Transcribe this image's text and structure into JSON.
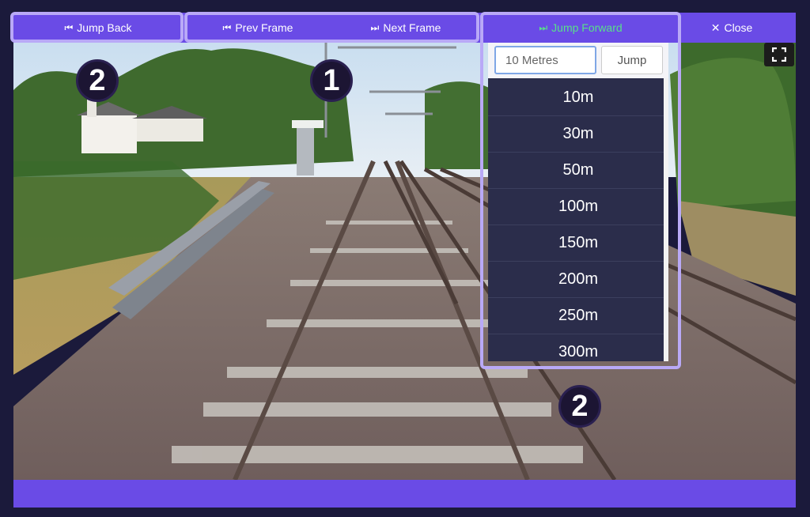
{
  "toolbar": {
    "jump_back": "Jump Back",
    "prev_frame": "Prev Frame",
    "next_frame": "Next Frame",
    "jump_forward": "Jump Forward",
    "close": "Close"
  },
  "badges": {
    "one": "1",
    "two_left": "2",
    "two_right": "2"
  },
  "jump_dropdown": {
    "input_value": "10 Metres",
    "jump_label": "Jump",
    "options": [
      "10m",
      "30m",
      "50m",
      "100m",
      "150m",
      "200m",
      "250m",
      "300m"
    ]
  },
  "colors": {
    "accent": "#6a4be6",
    "highlight": "#b9a9f7",
    "jump_forward_text": "#58e08a",
    "background": "#1b1a3b"
  },
  "icons": {
    "jump_back": "skip-backward-icon",
    "prev_frame": "step-backward-icon",
    "next_frame": "step-forward-icon",
    "jump_forward": "skip-forward-icon",
    "close": "close-icon",
    "fullscreen": "fullscreen-icon"
  }
}
